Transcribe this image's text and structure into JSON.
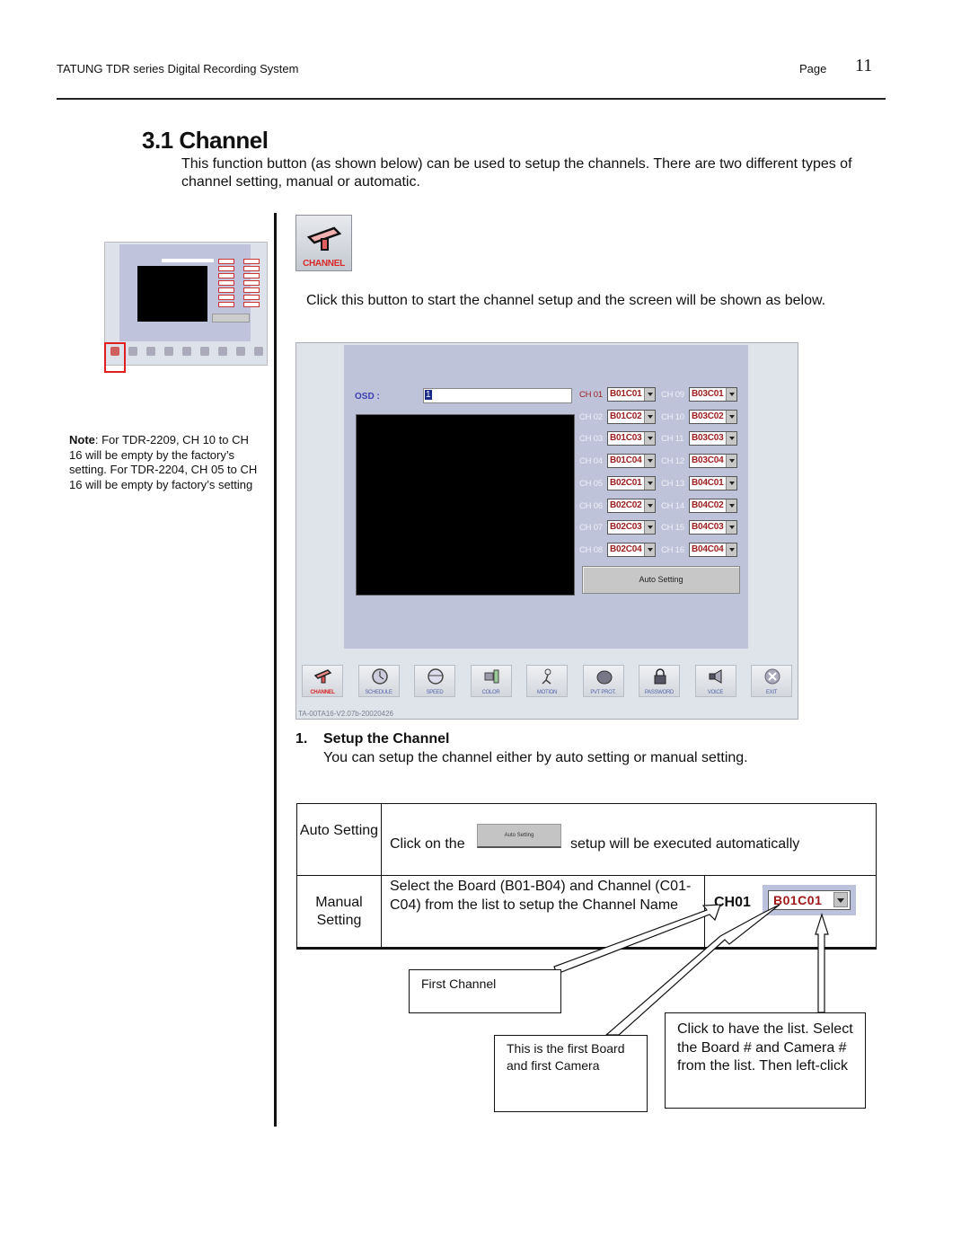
{
  "header": {
    "doc_title": "TATUNG TDR series Digital Recording System",
    "page_label": "Page",
    "page_number": "11"
  },
  "section": {
    "title": "3.1 Channel",
    "intro": "This function button (as shown below) can be used to setup the channels. There are two different types of channel setting, manual or automatic."
  },
  "note": {
    "label": "Note",
    "text": ": For TDR-2209, CH 10 to CH 16 will be empty by the factory’s setting. For TDR-2204, CH 05 to CH 16 will be empty by factory’s setting"
  },
  "channel_button": {
    "label": "CHANNEL",
    "icon": "camera-icon"
  },
  "click_instruction": "Click this button to start the channel setup and the screen will be shown as below.",
  "app": {
    "osd_label": "OSD :",
    "osd_value": "1",
    "channels": [
      {
        "label": "CH 01",
        "value": "B01C01",
        "active": true
      },
      {
        "label": "CH 02",
        "value": "B01C02",
        "active": false
      },
      {
        "label": "CH 03",
        "value": "B01C03",
        "active": false
      },
      {
        "label": "CH 04",
        "value": "B01C04",
        "active": false
      },
      {
        "label": "CH 05",
        "value": "B02C01",
        "active": false
      },
      {
        "label": "CH 06",
        "value": "B02C02",
        "active": false
      },
      {
        "label": "CH 07",
        "value": "B02C03",
        "active": false
      },
      {
        "label": "CH 08",
        "value": "B02C04",
        "active": false
      },
      {
        "label": "CH 09",
        "value": "B03C01",
        "active": false
      },
      {
        "label": "CH 10",
        "value": "B03C02",
        "active": false
      },
      {
        "label": "CH 11",
        "value": "B03C03",
        "active": false
      },
      {
        "label": "CH 12",
        "value": "B03C04",
        "active": false
      },
      {
        "label": "CH 13",
        "value": "B04C01",
        "active": false
      },
      {
        "label": "CH 14",
        "value": "B04C02",
        "active": false
      },
      {
        "label": "CH 15",
        "value": "B04C03",
        "active": false
      },
      {
        "label": "CH 16",
        "value": "B04C04",
        "active": false
      }
    ],
    "auto_setting_label": "Auto Setting",
    "toolbar": [
      {
        "label": "CHANNEL",
        "icon": "camera-icon"
      },
      {
        "label": "SCHEDULE",
        "icon": "clock-icon"
      },
      {
        "label": "SPEED",
        "icon": "speedometer-icon"
      },
      {
        "label": "COLOR",
        "icon": "color-icon"
      },
      {
        "label": "MOTION",
        "icon": "motion-icon"
      },
      {
        "label": "PVT PROT.",
        "icon": "privacy-icon"
      },
      {
        "label": "PASSWORD",
        "icon": "lock-icon"
      },
      {
        "label": "VOICE",
        "icon": "speaker-icon"
      },
      {
        "label": "EXIT",
        "icon": "close-icon"
      }
    ],
    "version": "TA-00TA16-V2.07b-20020426",
    "accent_color": "#9b1d1d"
  },
  "setup": {
    "number": "1.",
    "title": "Setup the Channel",
    "description": "You can setup the channel either by auto setting or manual setting."
  },
  "table": {
    "auto": {
      "head": "Auto Setting",
      "text_before": "Click on the",
      "button_label": "Auto Setting",
      "text_after": "setup will be executed automatically"
    },
    "manual": {
      "head": "Manual Setting",
      "text": "Select the Board (B01-B04) and Channel (C01-C04) from the list to setup the Channel Name",
      "channel_label": "CH01",
      "channel_value": "B01C01"
    }
  },
  "callouts": {
    "first_channel": "First Channel",
    "board_camera": "This is the first Board and first Camera",
    "click_list": "Click to have the list. Select the Board # and Camera # from the list. Then left-click"
  }
}
